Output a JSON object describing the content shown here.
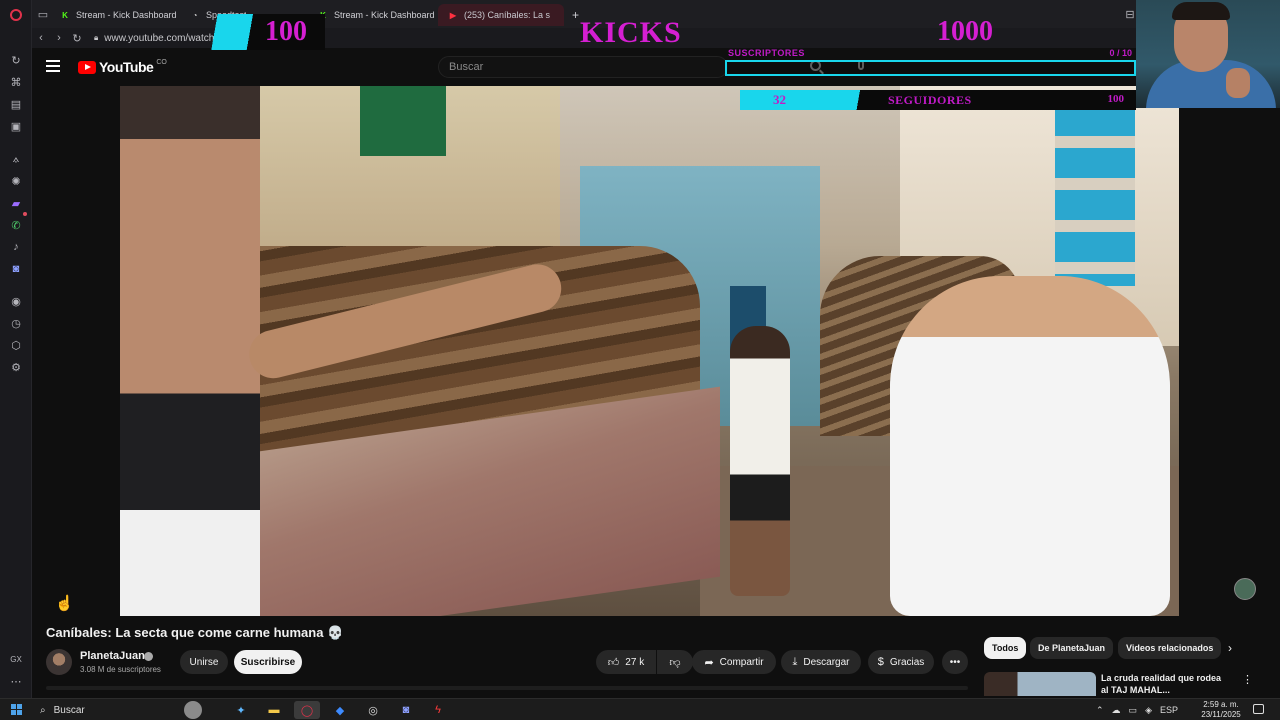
{
  "browser": {
    "tabs": [
      {
        "label": "Stream - Kick Dashboard",
        "favicon": "K",
        "color": "#53fc18"
      },
      {
        "label": "Speedtest",
        "favicon": "◔",
        "color": "#cccccc"
      },
      {
        "label": "Stream - Kick Dashboard",
        "favicon": "K",
        "color": "#53fc18"
      },
      {
        "label": "(253) Caníbales: La s",
        "favicon": "▶",
        "color": "#ff3040"
      }
    ],
    "new_tab_icon": "+",
    "pin_icon": "⊟",
    "url": "www.youtube.com/watch",
    "sidebar_bottom_label": "GX"
  },
  "overlay": {
    "kicks_title": "KICKS",
    "kicks_current": "100",
    "kicks_goal": "1000",
    "subs_label": "SUSCRIPTORES",
    "subs_count": "0 / 10",
    "subs_progress": 0,
    "followers_current": "32",
    "followers_label": "SEGUIDORES",
    "followers_goal": "100",
    "followers_progress": 0.32
  },
  "youtube": {
    "logo_text": "YouTube",
    "country_code": "CO",
    "search_placeholder": "Buscar",
    "video": {
      "title": "Caníbales: La secta que come carne humana 💀",
      "channel_name": "PlanetaJuan",
      "channel_subs": "3.08 M de suscriptores",
      "join_label": "Unirse",
      "subscribe_label": "Suscribirse",
      "likes": "27 k",
      "share_label": "Compartir",
      "download_label": "Descargar",
      "thanks_label": "Gracias",
      "more_icon": "•••"
    },
    "chips": [
      "Todos",
      "De PlanetaJuan",
      "Videos relacionados"
    ],
    "chip_next_icon": "›",
    "related": {
      "title": "La cruda realidad que rodea al TAJ MAHAL...",
      "menu_icon": "⋮"
    }
  },
  "taskbar": {
    "search_label": "Buscar",
    "tray_language": "ESP",
    "time": "2:59 a. m.",
    "date": "23/11/2025"
  }
}
